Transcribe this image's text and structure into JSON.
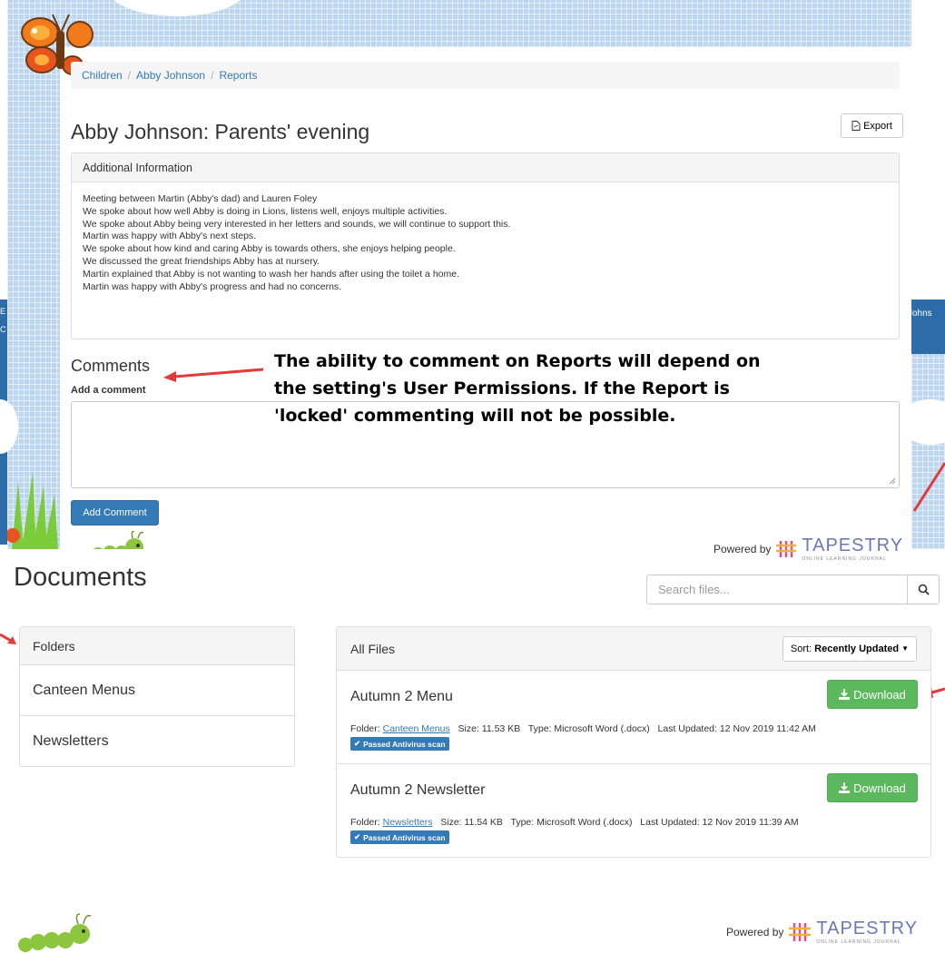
{
  "report_page": {
    "breadcrumb": [
      "Children",
      "Abby Johnson",
      "Reports"
    ],
    "title": "Abby Johnson: Parents' evening",
    "export_label": "Export",
    "info_heading": "Additional Information",
    "info_lines": [
      "Meeting between Martin (Abby's dad) and Lauren Foley",
      "We spoke about how well Abby is doing in Lions, listens well, enjoys multiple activities.",
      "We spoke about Abby being very interested in her letters and sounds, we will continue to support this.",
      "Martin was happy with Abby's next steps.",
      "We spoke about how kind and caring Abby is towards others, she enjoys helping people.",
      "We discussed the great friendships Abby has at nursery.",
      "Martin explained that Abby is not wanting to wash her hands after using the toilet a home.",
      "Martin was happy with Abby's progress and had no concerns."
    ],
    "comments_title": "Comments",
    "add_comment_label": "Add a comment",
    "add_comment_button": "Add Comment",
    "powered_by": "Powered by",
    "brand": "TAPESTRY",
    "brand_sub": "ONLINE LEARNING JOURNAL",
    "side_fragment_right": "Johns",
    "side_fragment_left": [
      "E",
      "C"
    ]
  },
  "annotation": {
    "line1": "The ability to comment on Reports will depend on",
    "line2": "the setting's User Permissions. If the Report is",
    "line3": "'locked' commenting will not be possible."
  },
  "documents_page": {
    "title": "Documents",
    "search_placeholder": "Search files...",
    "folders_heading": "Folders",
    "folders": [
      "Canteen Menus",
      "Newsletters"
    ],
    "files_heading": "All Files",
    "sort_label": "Sort:",
    "sort_value": "Recently Updated",
    "files": [
      {
        "name": "Autumn 2 Menu",
        "download_label": "Download",
        "folder_label": "Folder:",
        "folder": "Canteen Menus",
        "size": "Size: 11.53 KB",
        "type": "Type: Microsoft Word (.docx)",
        "updated": "Last Updated: 12 Nov 2019 11:42 AM",
        "badge": "Passed Antivirus scan"
      },
      {
        "name": "Autumn 2 Newsletter",
        "download_label": "Download",
        "folder_label": "Folder:",
        "folder": "Newsletters",
        "size": "Size: 11.54 KB",
        "type": "Type: Microsoft Word (.docx)",
        "updated": "Last Updated: 12 Nov 2019 11:39 AM",
        "badge": "Passed Antivirus scan"
      }
    ],
    "powered_by": "Powered by",
    "brand": "TAPESTRY",
    "brand_sub": "ONLINE LEARNING JOURNAL"
  },
  "colors": {
    "link": "#337ab7",
    "primary_button": "#337ab7",
    "success_button": "#5cb85c",
    "annotation_arrow": "#e03a3a",
    "grid_background": "#bcd6f0"
  }
}
